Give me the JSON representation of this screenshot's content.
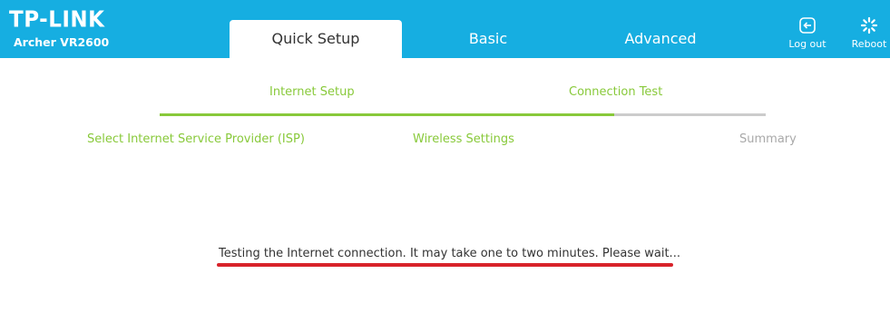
{
  "header": {
    "brand": "TP-LINK",
    "model": "Archer VR2600",
    "tabs": [
      {
        "label": "Quick Setup",
        "active": true
      },
      {
        "label": "Basic",
        "active": false
      },
      {
        "label": "Advanced",
        "active": false
      }
    ],
    "logout_label": "Log out",
    "reboot_label": "Reboot",
    "logout_icon": "logout-icon",
    "reboot_icon": "reboot-icon"
  },
  "steps": {
    "top": [
      {
        "label": "Internet Setup",
        "state": "done"
      },
      {
        "label": "Connection Test",
        "state": "current"
      }
    ],
    "bottom": [
      {
        "label": "Select Internet Service Provider (ISP)",
        "state": "done"
      },
      {
        "label": "Wireless Settings",
        "state": "done"
      },
      {
        "label": "Summary",
        "state": "pending"
      }
    ],
    "progress_fraction": 0.75
  },
  "status": {
    "message": "Testing the Internet connection. It may take one to two minutes. Please wait..."
  },
  "colors": {
    "header_bg": "#16aee1",
    "accent_green": "#88c93a",
    "pending_gray": "#a9a9a9",
    "track_gray": "#cccccc",
    "annotation_red": "#d8232a"
  }
}
